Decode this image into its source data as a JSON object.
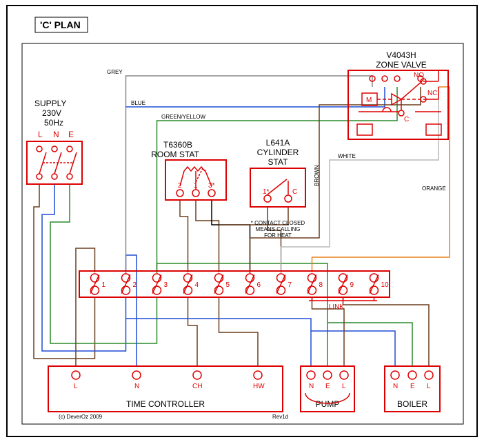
{
  "title": "'C' PLAN",
  "supply": {
    "label": "SUPPLY",
    "voltage": "230V",
    "freq": "50Hz",
    "terms": [
      "L",
      "N",
      "E"
    ]
  },
  "roomstat": {
    "model": "T6360B",
    "label": "ROOM STAT",
    "terms": [
      "2",
      "1",
      "3*"
    ]
  },
  "cylstat": {
    "model": "L641A",
    "label": "CYLINDER",
    "label2": "STAT",
    "terms": [
      "1*",
      "C"
    ],
    "note": "* CONTACT CLOSED MEANS CALLING FOR HEAT"
  },
  "zonevalve": {
    "model": "V4043H",
    "label": "ZONE VALVE",
    "M": "M",
    "C": "C",
    "NO": "NO",
    "NC": "NC"
  },
  "link": "LINK",
  "junction_terms": [
    "1",
    "2",
    "3",
    "4",
    "5",
    "6",
    "7",
    "8",
    "9",
    "10"
  ],
  "timecontroller": {
    "label": "TIME CONTROLLER",
    "terms": [
      "L",
      "N",
      "CH",
      "HW"
    ]
  },
  "pump": {
    "label": "PUMP",
    "terms": [
      "N",
      "E",
      "L"
    ]
  },
  "boiler": {
    "label": "BOILER",
    "terms": [
      "N",
      "E",
      "L"
    ]
  },
  "wire_labels": {
    "grey": "GREY",
    "blue": "BLUE",
    "greenyellow": "GREEN/YELLOW",
    "brown": "BROWN",
    "white": "WHITE",
    "orange": "ORANGE"
  },
  "footer": {
    "copyright": "(c) DeverOz 2009",
    "rev": "Rev1d"
  }
}
